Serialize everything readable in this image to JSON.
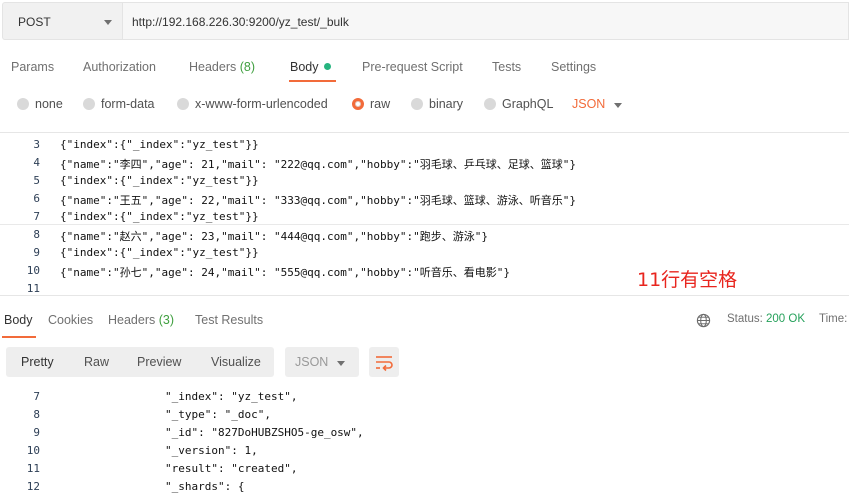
{
  "request": {
    "method": "POST",
    "url": "http://192.168.226.30:9200/yz_test/_bulk"
  },
  "request_tabs": [
    {
      "label": "Params"
    },
    {
      "label": "Authorization"
    },
    {
      "label": "Headers",
      "count": "(8)"
    },
    {
      "label": "Body"
    },
    {
      "label": "Pre-request Script"
    },
    {
      "label": "Tests"
    },
    {
      "label": "Settings"
    }
  ],
  "body_types": [
    {
      "label": "none"
    },
    {
      "label": "form-data"
    },
    {
      "label": "x-www-form-urlencoded"
    },
    {
      "label": "raw"
    },
    {
      "label": "binary"
    },
    {
      "label": "GraphQL"
    }
  ],
  "body_format": "JSON",
  "editor_lines": [
    {
      "n": "3",
      "text": "{\"index\":{\"_index\":\"yz_test\"}}"
    },
    {
      "n": "4",
      "text": "{\"name\":\"李四\",\"age\": 21,\"mail\": \"222@qq.com\",\"hobby\":\"羽毛球、乒乓球、足球、篮球\"}"
    },
    {
      "n": "5",
      "text": "{\"index\":{\"_index\":\"yz_test\"}}"
    },
    {
      "n": "6",
      "text": "{\"name\":\"王五\",\"age\": 22,\"mail\": \"333@qq.com\",\"hobby\":\"羽毛球、篮球、游泳、听音乐\"}"
    },
    {
      "n": "7",
      "text": "{\"index\":{\"_index\":\"yz_test\"}}"
    },
    {
      "n": "8",
      "text": "{\"name\":\"赵六\",\"age\": 23,\"mail\": \"444@qq.com\",\"hobby\":\"跑步、游泳\"}"
    },
    {
      "n": "9",
      "text": "{\"index\":{\"_index\":\"yz_test\"}}"
    },
    {
      "n": "10",
      "text": "{\"name\":\"孙七\",\"age\": 24,\"mail\": \"555@qq.com\",\"hobby\":\"听音乐、看电影\"}"
    },
    {
      "n": "11",
      "text": ""
    }
  ],
  "annotation": "11行有空格",
  "response_tabs": [
    {
      "label": "Body"
    },
    {
      "label": "Cookies"
    },
    {
      "label": "Headers",
      "count": "(3)"
    },
    {
      "label": "Test Results"
    }
  ],
  "response_status": {
    "label": "Status:",
    "value": "200 OK",
    "time_label": "Time:"
  },
  "view_modes": [
    {
      "label": "Pretty"
    },
    {
      "label": "Raw"
    },
    {
      "label": "Preview"
    },
    {
      "label": "Visualize"
    }
  ],
  "response_format": "JSON",
  "response_lines": [
    {
      "n": "7",
      "text": "\"_index\": \"yz_test\","
    },
    {
      "n": "8",
      "text": "\"_type\": \"_doc\","
    },
    {
      "n": "9",
      "text": "\"_id\": \"827DoHUBZSHO5-ge_osw\","
    },
    {
      "n": "10",
      "text": "\"_version\": 1,"
    },
    {
      "n": "11",
      "text": "\"result\": \"created\","
    },
    {
      "n": "12",
      "text": "\"_shards\": {"
    }
  ],
  "colors": {
    "accent": "#f26b3a",
    "success": "#26a15b",
    "annotation": "#e8251e"
  },
  "icons": [
    "caret-down-icon",
    "globe-icon",
    "wrap-lines-icon",
    "radio-icon",
    "status-dot-icon"
  ]
}
